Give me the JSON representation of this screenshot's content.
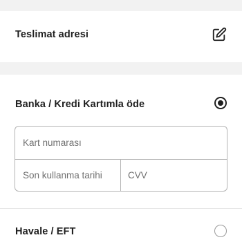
{
  "address": {
    "title": "Teslimat adresi",
    "edit_icon": "edit-icon"
  },
  "payment": {
    "card_option": {
      "title": "Banka / Kredi Kartımla öde",
      "selected": true,
      "fields": {
        "card_number_placeholder": "Kart numarası",
        "expiry_placeholder": "Son kullanma tarihi",
        "cvv_placeholder": "CVV"
      }
    },
    "eft_option": {
      "title": "Havale / EFT",
      "selected": false
    }
  },
  "colors": {
    "text": "#1f1f1f",
    "placeholder": "#6f6f6f",
    "border": "#b3b3b3",
    "section_gap": "#f2f2f2",
    "radio_unselected": "#9a9a9a"
  }
}
